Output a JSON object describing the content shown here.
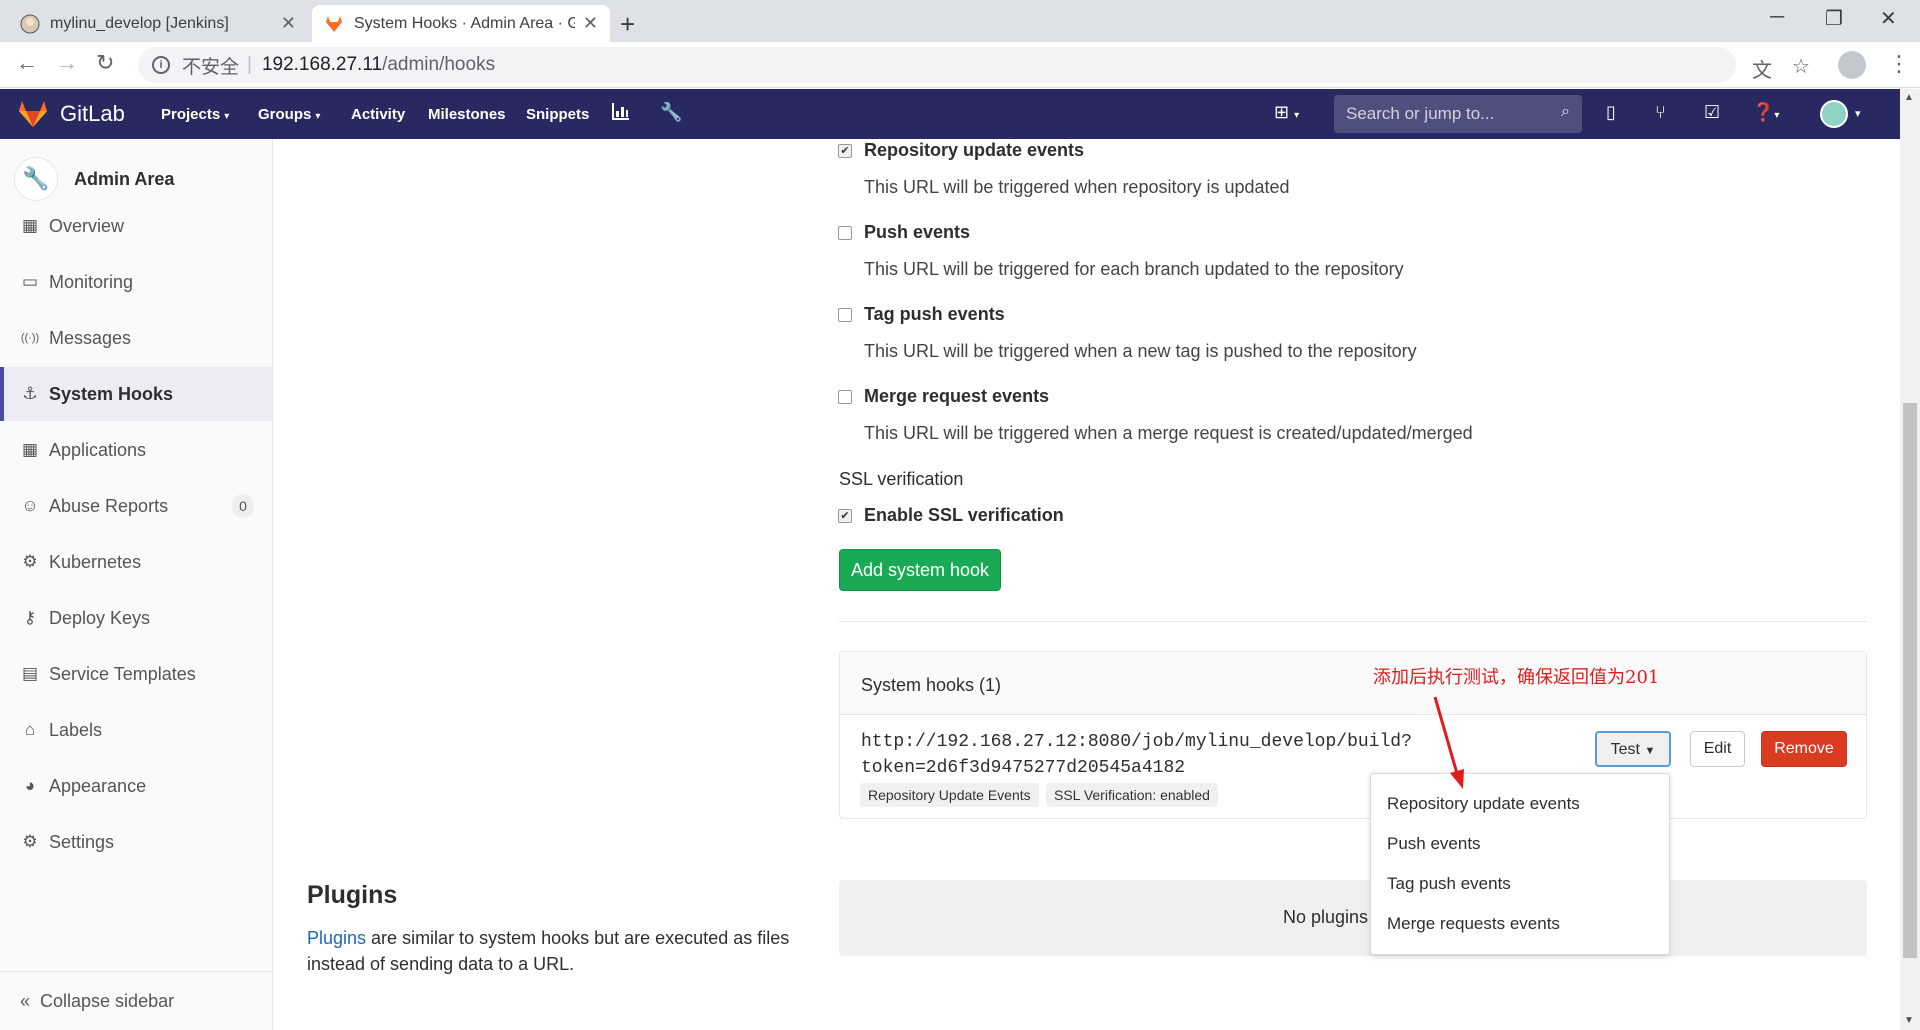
{
  "browser": {
    "tabs": [
      {
        "title": "mylinu_develop [Jenkins]",
        "active": false
      },
      {
        "title": "System Hooks · Admin Area · G",
        "active": true
      }
    ],
    "address": {
      "insecure_label": "不安全",
      "host": "192.168.27.11",
      "path": "/admin/hooks"
    }
  },
  "gitlab_header": {
    "brand": "GitLab",
    "nav": [
      {
        "label": "Projects",
        "dropdown": true
      },
      {
        "label": "Groups",
        "dropdown": true
      },
      {
        "label": "Activity",
        "dropdown": false
      },
      {
        "label": "Milestones",
        "dropdown": false
      },
      {
        "label": "Snippets",
        "dropdown": false
      }
    ],
    "search_placeholder": "Search or jump to..."
  },
  "sidebar": {
    "title": "Admin Area",
    "items": [
      {
        "label": "Overview",
        "icon": "grid-icon"
      },
      {
        "label": "Monitoring",
        "icon": "monitor-icon"
      },
      {
        "label": "Messages",
        "icon": "broadcast-icon"
      },
      {
        "label": "System Hooks",
        "icon": "hook-icon",
        "active": true
      },
      {
        "label": "Applications",
        "icon": "apps-icon"
      },
      {
        "label": "Abuse Reports",
        "icon": "smiley-icon",
        "badge": "0"
      },
      {
        "label": "Kubernetes",
        "icon": "cloud-gear-icon"
      },
      {
        "label": "Deploy Keys",
        "icon": "key-icon"
      },
      {
        "label": "Service Templates",
        "icon": "template-icon"
      },
      {
        "label": "Labels",
        "icon": "labels-icon"
      },
      {
        "label": "Appearance",
        "icon": "palette-icon"
      },
      {
        "label": "Settings",
        "icon": "gear-icon"
      }
    ],
    "collapse_label": "Collapse sidebar"
  },
  "triggers": [
    {
      "label": "Repository update events",
      "help": "This URL will be triggered when repository is updated",
      "checked": true
    },
    {
      "label": "Push events",
      "help": "This URL will be triggered for each branch updated to the repository",
      "checked": false
    },
    {
      "label": "Tag push events",
      "help": "This URL will be triggered when a new tag is pushed to the repository",
      "checked": false
    },
    {
      "label": "Merge request events",
      "help": "This URL will be triggered when a merge request is created/updated/merged",
      "checked": false
    }
  ],
  "ssl": {
    "title": "SSL verification",
    "label": "Enable SSL verification",
    "checked": true
  },
  "add_button": "Add system hook",
  "hooks": {
    "title": "System hooks (1)",
    "url_line1": "http://192.168.27.12:8080/job/mylinu_develop/build?",
    "url_line2": "token=2d6f3d9475277d20545a4182",
    "tags": [
      "Repository Update Events",
      "SSL Verification: enabled"
    ],
    "test_label": "Test",
    "edit_label": "Edit",
    "remove_label": "Remove",
    "test_menu": [
      "Repository update events",
      "Push events",
      "Tag push events",
      "Merge requests events"
    ]
  },
  "plugins": {
    "title": "Plugins",
    "link_text": "Plugins",
    "desc_rest": " are similar to system hooks but are executed as files instead of sending data to a URL.",
    "empty_text": "No plugins"
  },
  "annotation": "添加后执行测试，确保返回值为201",
  "colors": {
    "header": "#292961",
    "accent": "#4b4ba3",
    "success": "#1aaa55",
    "danger": "#db3b21",
    "annotation": "#e01c1c"
  }
}
